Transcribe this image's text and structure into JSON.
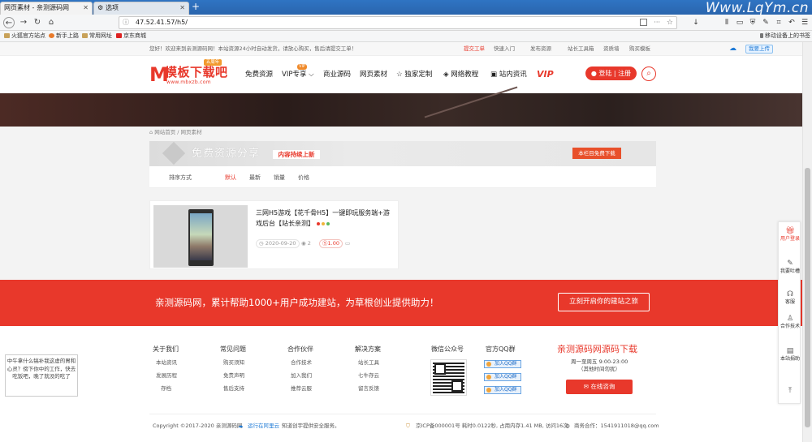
{
  "browser": {
    "tabs": [
      {
        "title": "网页素材 - 亲测源码网"
      },
      {
        "title": "选项"
      }
    ],
    "new_tab": "+",
    "watermark": "Www.LqYm.cn",
    "url": "47.52.41.57/h5/",
    "bookmarks": [
      "火狐官方站点",
      "新手上路",
      "常用网址",
      "京东商城"
    ],
    "mobile_bookmarks": "移动设备上的书签"
  },
  "topstrip": {
    "welcome": "您好！欢迎来到亲测源码网！本站资源24小时自动发货，请放心购买，售后请提交工单！",
    "links": [
      "提交工单",
      "快速入门",
      "发布资源",
      "站长工具箱",
      "资质墙",
      "购买模板"
    ],
    "upload": "我要上传"
  },
  "header": {
    "logo_text": "模板下载吧",
    "logo_url": "www.mbxzb.com",
    "logo_badge": "五周年",
    "nav": [
      "免费资源",
      "VIP专享",
      "商业源码",
      "网页素材",
      "独家定制",
      "网络教程",
      "站内资讯"
    ],
    "vip_badge": "VIP",
    "vip_logo": "VIP",
    "login": "登陆 | 注册"
  },
  "breadcrumb": [
    "网站首页",
    "网页素材"
  ],
  "banner": {
    "title": "免费资源分享",
    "tag": "内容持续上新",
    "right": "本栏目免费下载"
  },
  "filter": {
    "label": "排序方式",
    "options": [
      "默认",
      "最新",
      "销量",
      "价格"
    ]
  },
  "card": {
    "title": "三网H5游戏【花千骨H5】一键即玩服务端+游戏后台【站长亲测】",
    "date": "2020-09-20",
    "views": "2",
    "price": "1.00",
    "dot_colors": [
      "#e8382b",
      "#f0b43a",
      "#5bb85d"
    ]
  },
  "redband": {
    "text": "亲测源码网，累计帮助1000+用户成功建站，为草根创业提供助力！",
    "button": "立刻开启你的建站之旅"
  },
  "footer": {
    "columns": [
      {
        "title": "关于我们",
        "items": [
          "本站资讯",
          "发展历程",
          "存档"
        ]
      },
      {
        "title": "常见问题",
        "items": [
          "购买须知",
          "免责声明",
          "售后支持"
        ]
      },
      {
        "title": "合作伙伴",
        "items": [
          "合作技术",
          "加入我们",
          "推荐云服"
        ]
      },
      {
        "title": "解决方案",
        "items": [
          "站长工具",
          "七牛存云",
          "留言反馈"
        ]
      }
    ],
    "wechat_title": "微信公众号",
    "qq_title": "官方QQ群",
    "qq_buttons": [
      "加入QQ群",
      "加入QQ群",
      "加入QQ群"
    ],
    "download_title": "亲测源码网源码下载",
    "hours": "周一至周五 9:00-23:00",
    "holiday": "（其他时间勿扰）",
    "consult": "在线咨询",
    "copyright": "Copyright ©2017-2020 亲测源码网",
    "cloud": "运行在阿里云",
    "security": "知道创宇提供安全服务。",
    "icp": "京ICP备000001号 耗时0.0122秒, 占用内存1.41 MB, 访问16次",
    "business": "商务合作：1541911018@qq.com"
  },
  "bubble": "中午拿什么犒补我这虚的胃和心灵？傍下你中的工作，快去吃饭吧，晚了就没的吃了",
  "sidebar": [
    {
      "label": "用户登录",
      "icon": "gift-icon"
    },
    {
      "label": "我要吐槽",
      "icon": "chat-icon"
    },
    {
      "label": "客服",
      "icon": "headset-icon"
    },
    {
      "label": "合作技术",
      "icon": "user-icon"
    },
    {
      "label": "本站捐助",
      "icon": "clipboard-icon"
    },
    {
      "label": "",
      "icon": "back-to-top-icon"
    }
  ]
}
